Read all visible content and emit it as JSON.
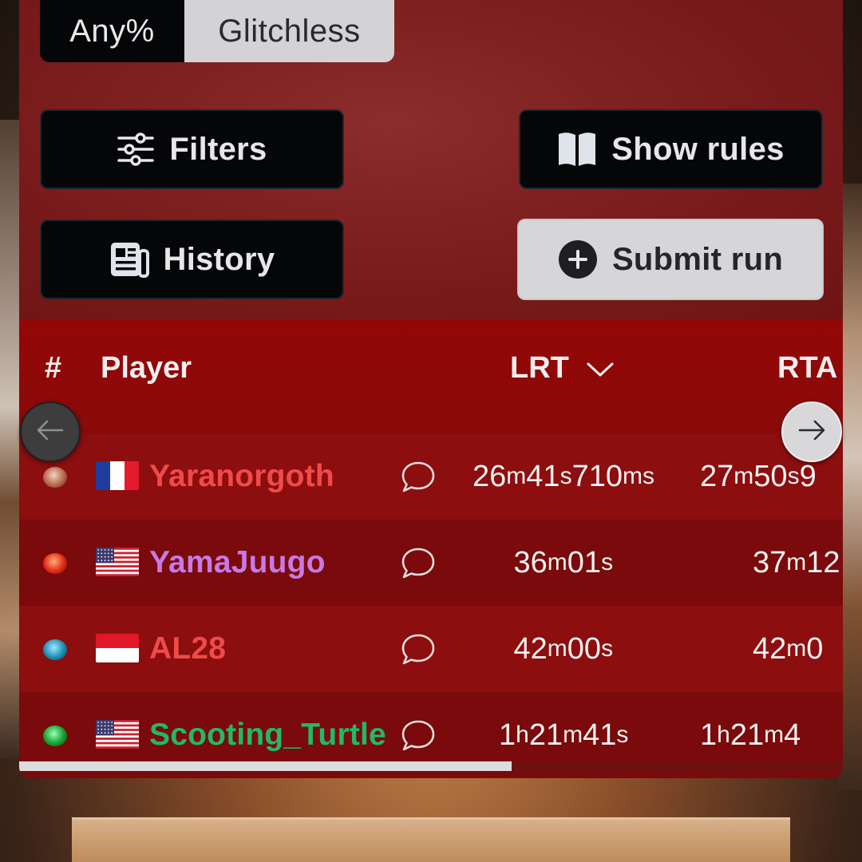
{
  "category_tabs": [
    {
      "label": "Any%",
      "active": true
    },
    {
      "label": "Glitchless",
      "active": false
    }
  ],
  "actions": {
    "filters_label": "Filters",
    "show_rules_label": "Show rules",
    "history_label": "History",
    "submit_run_label": "Submit run"
  },
  "table": {
    "headers": {
      "rank": "#",
      "player": "Player",
      "lrt": "LRT",
      "rta": "RTA"
    },
    "sort_column": "LRT",
    "rows": [
      {
        "trophy": "gold-trophy-icon",
        "flag": "france-flag-icon",
        "player": "Yaranorgoth",
        "player_color": "#f04a4a",
        "lrt": [
          [
            "26",
            "m"
          ],
          [
            " 41",
            "s"
          ],
          [
            " 710",
            "ms"
          ]
        ],
        "rta": [
          [
            "27",
            "m"
          ],
          [
            " 50",
            "s"
          ],
          [
            " 9",
            ""
          ]
        ]
      },
      {
        "trophy": "red-trophy-icon",
        "flag": "usa-flag-icon",
        "player": "YamaJuugo",
        "player_color": "#c77ae6",
        "lrt": [
          [
            "36",
            "m"
          ],
          [
            " 01",
            "s"
          ]
        ],
        "rta": [
          [
            "37",
            "m"
          ],
          [
            " 12",
            ""
          ]
        ]
      },
      {
        "trophy": "blue-trophy-icon",
        "flag": "indonesia-flag-icon",
        "player": "AL28",
        "player_color": "#f04a4a",
        "lrt": [
          [
            "42",
            "m"
          ],
          [
            " 00",
            "s"
          ]
        ],
        "rta": [
          [
            "42",
            "m"
          ],
          [
            " 0",
            ""
          ]
        ]
      },
      {
        "trophy": "green-trophy-icon",
        "flag": "usa-flag-icon",
        "player": "Scooting_Turtle",
        "player_color": "#22b86a",
        "lrt": [
          [
            "1",
            "h"
          ],
          [
            " 21",
            "m"
          ],
          [
            " 41",
            "s"
          ]
        ],
        "rta": [
          [
            "1",
            "h"
          ],
          [
            " 21",
            "m"
          ],
          [
            " 4",
            ""
          ]
        ]
      }
    ]
  },
  "colors": {
    "card_bg": "#761415",
    "header_bg": "#940707",
    "dark_button": "#050608",
    "light_button": "#d6d6d8"
  },
  "icons": {
    "filters": "sliders-icon",
    "show_rules": "book-icon",
    "history": "newspaper-icon",
    "submit_run": "plus-circle-icon",
    "sort": "chevron-down-icon",
    "comment": "speech-bubble-icon",
    "scroll_left": "arrow-left-icon",
    "scroll_right": "arrow-right-icon"
  }
}
